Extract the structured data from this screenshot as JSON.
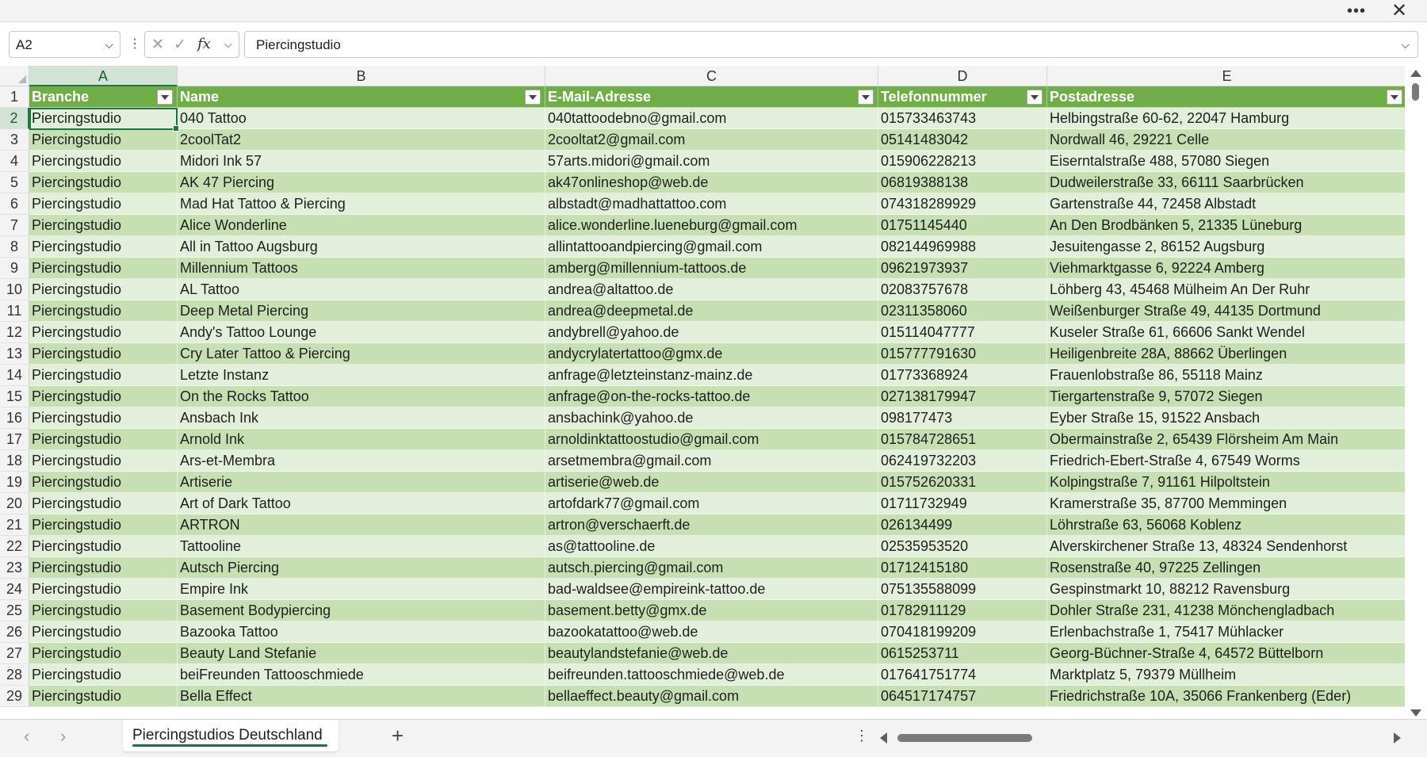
{
  "title_bar": {
    "more_icon": "more-horizontal-icon",
    "close_icon": "close-icon"
  },
  "formula_bar": {
    "name_box": "A2",
    "formula_value": "Piercingstudio",
    "fx_label": "fx"
  },
  "columns": [
    "A",
    "B",
    "C",
    "D",
    "E"
  ],
  "selected_column": "A",
  "selected_row": "2",
  "table": {
    "headers": [
      "Branche",
      "Name",
      "E-Mail-Adresse",
      "Telefonnummer",
      "Postadresse"
    ],
    "rows": [
      {
        "num": "2",
        "cells": [
          "Piercingstudio",
          "040 Tattoo",
          "040tattoodebno@gmail.com",
          "015733463743",
          "Helbingstraße 60-62, 22047 Hamburg"
        ]
      },
      {
        "num": "3",
        "cells": [
          "Piercingstudio",
          "2coolTat2",
          "2cooltat2@gmail.com",
          "05141483042",
          "Nordwall 46, 29221 Celle"
        ]
      },
      {
        "num": "4",
        "cells": [
          "Piercingstudio",
          "Midori Ink 57",
          "57arts.midori@gmail.com",
          "015906228213",
          "Eiserntalstraße 488, 57080 Siegen"
        ]
      },
      {
        "num": "5",
        "cells": [
          "Piercingstudio",
          "AK 47 Piercing",
          "ak47onlineshop@web.de",
          "06819388138",
          "Dudweilerstraße 33, 66111 Saarbrücken"
        ]
      },
      {
        "num": "6",
        "cells": [
          "Piercingstudio",
          "Mad Hat Tattoo & Piercing",
          "albstadt@madhattattoo.com",
          "074318289929",
          "Gartenstraße 44, 72458 Albstadt"
        ]
      },
      {
        "num": "7",
        "cells": [
          "Piercingstudio",
          "Alice Wonderline",
          "alice.wonderline.lueneburg@gmail.com",
          "01751145440",
          "An Den Brodbänken 5, 21335 Lüneburg"
        ]
      },
      {
        "num": "8",
        "cells": [
          "Piercingstudio",
          "All in Tattoo Augsburg",
          "allintattooandpiercing@gmail.com",
          "082144969988",
          "Jesuitengasse 2, 86152 Augsburg"
        ]
      },
      {
        "num": "9",
        "cells": [
          "Piercingstudio",
          "Millennium Tattoos",
          "amberg@millennium-tattoos.de",
          "09621973937",
          "Viehmarktgasse 6, 92224 Amberg"
        ]
      },
      {
        "num": "10",
        "cells": [
          "Piercingstudio",
          "AL Tattoo",
          "andrea@altattoo.de",
          "02083757678",
          "Löhberg 43, 45468 Mülheim An Der Ruhr"
        ]
      },
      {
        "num": "11",
        "cells": [
          "Piercingstudio",
          "Deep Metal Piercing",
          "andrea@deepmetal.de",
          "02311358060",
          "Weißenburger Straße 49, 44135 Dortmund"
        ]
      },
      {
        "num": "12",
        "cells": [
          "Piercingstudio",
          "Andy's Tattoo Lounge",
          "andybrell@yahoo.de",
          "015114047777",
          "Kuseler Straße 61, 66606 Sankt Wendel"
        ]
      },
      {
        "num": "13",
        "cells": [
          "Piercingstudio",
          "Cry Later Tattoo & Piercing",
          "andycrylatertattoo@gmx.de",
          "015777791630",
          "Heiligenbreite 28A, 88662 Überlingen"
        ]
      },
      {
        "num": "14",
        "cells": [
          "Piercingstudio",
          "Letzte Instanz",
          "anfrage@letzteinstanz-mainz.de",
          "01773368924",
          "Frauenlobstraße 86, 55118 Mainz"
        ]
      },
      {
        "num": "15",
        "cells": [
          "Piercingstudio",
          "On the Rocks Tattoo",
          "anfrage@on-the-rocks-tattoo.de",
          "027138179947",
          "Tiergartenstraße 9, 57072 Siegen"
        ]
      },
      {
        "num": "16",
        "cells": [
          "Piercingstudio",
          "Ansbach Ink",
          "ansbachink@yahoo.de",
          "098177473",
          "Eyber Straße 15, 91522 Ansbach"
        ]
      },
      {
        "num": "17",
        "cells": [
          "Piercingstudio",
          "Arnold Ink",
          "arnoldinktattoostudio@gmail.com",
          "015784728651",
          "Obermainstraße 2, 65439 Flörsheim Am Main"
        ]
      },
      {
        "num": "18",
        "cells": [
          "Piercingstudio",
          "Ars-et-Membra",
          "arsetmembra@gmail.com",
          "062419732203",
          "Friedrich-Ebert-Straße 4, 67549 Worms"
        ]
      },
      {
        "num": "19",
        "cells": [
          "Piercingstudio",
          "Artiserie",
          "artiserie@web.de",
          "015752620331",
          "Kolpingstraße 7, 91161 Hilpoltstein"
        ]
      },
      {
        "num": "20",
        "cells": [
          "Piercingstudio",
          "Art of Dark Tattoo",
          "artofdark77@gmail.com",
          "01711732949",
          "Kramerstraße 35, 87700 Memmingen"
        ]
      },
      {
        "num": "21",
        "cells": [
          "Piercingstudio",
          "ARTRON",
          "artron@verschaerft.de",
          "026134499",
          "Löhrstraße 63, 56068 Koblenz"
        ]
      },
      {
        "num": "22",
        "cells": [
          "Piercingstudio",
          "Tattooline",
          "as@tattooline.de",
          "02535953520",
          "Alverskirchener Straße 13, 48324 Sendenhorst"
        ]
      },
      {
        "num": "23",
        "cells": [
          "Piercingstudio",
          "Autsch Piercing",
          "autsch.piercing@gmail.com",
          "01712415180",
          "Rosenstraße 40, 97225 Zellingen"
        ]
      },
      {
        "num": "24",
        "cells": [
          "Piercingstudio",
          "Empire Ink",
          "bad-waldsee@empireink-tattoo.de",
          "075135588099",
          "Gespinstmarkt 10, 88212 Ravensburg"
        ]
      },
      {
        "num": "25",
        "cells": [
          "Piercingstudio",
          "Basement Bodypiercing",
          "basement.betty@gmx.de",
          "01782911129",
          "Dohler Straße 231, 41238 Mönchengladbach"
        ]
      },
      {
        "num": "26",
        "cells": [
          "Piercingstudio",
          "Bazooka Tattoo",
          "bazookatattoo@web.de",
          "070418199209",
          "Erlenbachstraße 1, 75417 Mühlacker"
        ]
      },
      {
        "num": "27",
        "cells": [
          "Piercingstudio",
          "Beauty Land Stefanie",
          "beautylandstefanie@web.de",
          "0615253711",
          "Georg-Büchner-Straße 4, 64572 Büttelborn"
        ]
      },
      {
        "num": "28",
        "cells": [
          "Piercingstudio",
          "beiFreunden Tattooschmiede",
          "beifreunden.tattooschmiede@web.de",
          "017641751774",
          "Marktplatz 5, 79379 Müllheim"
        ]
      },
      {
        "num": "29",
        "cells": [
          "Piercingstudio",
          "Bella Effect",
          "bellaeffect.beauty@gmail.com",
          "064517174757",
          "Friedrichstraße 10A, 35066 Frankenberg (Eder)"
        ]
      }
    ]
  },
  "sheet_tabs": {
    "active": "Piercingstudios Deutschland",
    "add_label": "+"
  },
  "colors": {
    "header_green": "#70ad47",
    "band_dark": "#c6e0b4",
    "band_light": "#e2efda",
    "selection": "#217346"
  }
}
